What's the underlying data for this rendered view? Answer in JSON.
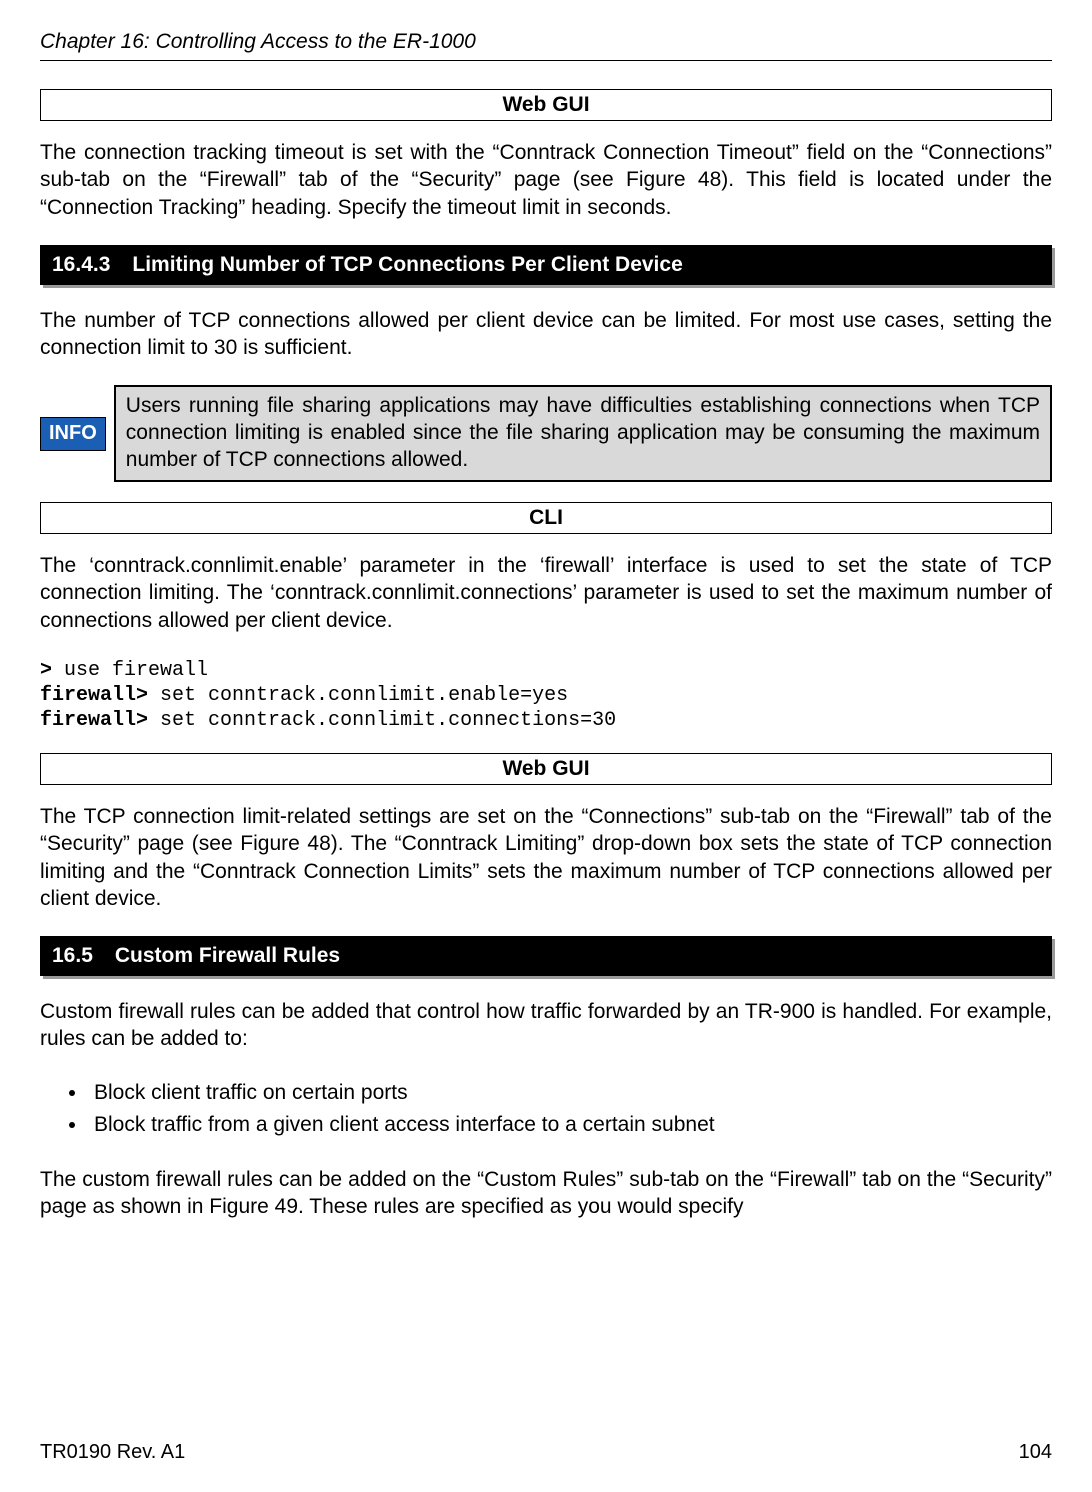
{
  "chapter": "Chapter 16: Controlling Access to the ER-1000",
  "webgui1": {
    "title": "Web GUI",
    "body": "The connection tracking timeout is set with the “Conntrack Connection Timeout” field on the “Connections” sub-tab on the “Firewall” tab of the “Security” page (see Figure 48). This field is located under the “Connection Tracking” heading. Specify the timeout limit in seconds."
  },
  "section_1643": {
    "number": "16.4.3",
    "title": "Limiting Number of TCP Connections Per Client Device",
    "intro": "The number of TCP connections allowed per client device can be limited. For most use cases, setting the connection limit to 30 is sufficient.",
    "info_badge": "INFO",
    "info_text": "Users running file sharing applications may have difficulties establishing connections when TCP connection limiting is enabled since the file sharing application may be consuming the maximum number of TCP connections allowed."
  },
  "cli": {
    "title": "CLI",
    "body": "The ‘conntrack.connlimit.enable’ parameter in the ‘firewall’ interface is used to set the state of TCP connection limiting. The ‘conntrack.connlimit.connections’ parameter is used to set the maximum number of connections allowed per client device.",
    "line1_prompt": ">",
    "line1_cmd": " use firewall",
    "line2_prompt": "firewall>",
    "line2_cmd": " set conntrack.connlimit.enable=yes",
    "line3_prompt": "firewall>",
    "line3_cmd": " set conntrack.connlimit.connections=30"
  },
  "webgui2": {
    "title": "Web GUI",
    "body": "The TCP connection limit-related settings are set on the “Connections” sub-tab on the “Firewall” tab of the “Security” page (see Figure 48). The “Conntrack Limiting” drop-down box sets the state of TCP connection limiting and the “Conntrack Connection Limits” sets the maximum number of TCP connections allowed per client device."
  },
  "section_165": {
    "number": "16.5",
    "title": "Custom Firewall Rules",
    "intro": "Custom firewall rules can be added that control how traffic forwarded by an TR-900 is handled. For example, rules can be added to:",
    "bullets": [
      "Block client traffic on certain ports",
      "Block traffic from a given client access interface to a certain subnet"
    ],
    "outro": "The custom firewall rules can be added on the “Custom Rules” sub-tab on the “Firewall” tab on the “Security” page as shown in Figure 49. These rules are specified as you would specify"
  },
  "footer": {
    "left": "TR0190 Rev. A1",
    "right": "104"
  }
}
